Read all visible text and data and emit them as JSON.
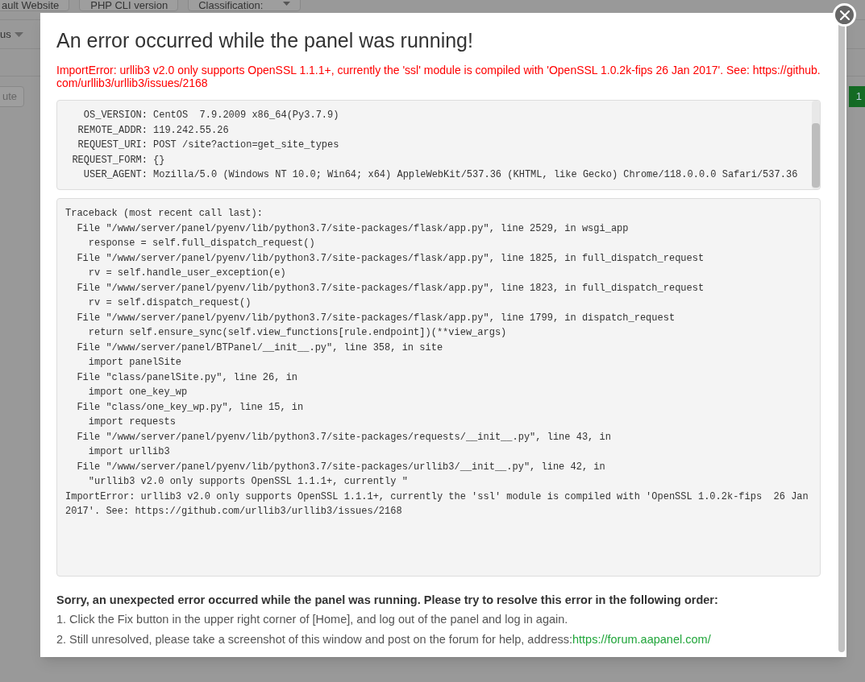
{
  "background": {
    "top_buttons": [
      "ault Website",
      "PHP CLI version"
    ],
    "classification_select": "Classification:",
    "left_menu": "us",
    "left_button": "ute",
    "page_badge": "1"
  },
  "dialog": {
    "title": "An error occurred while the panel was running!",
    "error_message": "ImportError: urllib3 v2.0 only supports OpenSSL 1.1.1+, currently the 'ssl' module is compiled with 'OpenSSL 1.0.2k-fips 26 Jan 2017'. See: https://github.com/urllib3/urllib3/issues/2168",
    "environment": [
      {
        "key": "OS_VERSION:",
        "value": "CentOS  7.9.2009 x86_64(Py3.7.9)"
      },
      {
        "key": "REMOTE_ADDR:",
        "value": "119.242.55.26"
      },
      {
        "key": "REQUEST_URI:",
        "value": "POST /site?action=get_site_types"
      },
      {
        "key": "REQUEST_FORM:",
        "value": "{}"
      },
      {
        "key": "USER_AGENT:",
        "value": "Mozilla/5.0 (Windows NT 10.0; Win64; x64) AppleWebKit/537.36 (KHTML, like Gecko) Chrome/118.0.0.0 Safari/537.36"
      }
    ],
    "traceback": [
      "Traceback (most recent call last):",
      "  File \"/www/server/panel/pyenv/lib/python3.7/site-packages/flask/app.py\", line 2529, in wsgi_app",
      "    response = self.full_dispatch_request()",
      "  File \"/www/server/panel/pyenv/lib/python3.7/site-packages/flask/app.py\", line 1825, in full_dispatch_request",
      "    rv = self.handle_user_exception(e)",
      "  File \"/www/server/panel/pyenv/lib/python3.7/site-packages/flask/app.py\", line 1823, in full_dispatch_request",
      "    rv = self.dispatch_request()",
      "  File \"/www/server/panel/pyenv/lib/python3.7/site-packages/flask/app.py\", line 1799, in dispatch_request",
      "    return self.ensure_sync(self.view_functions[rule.endpoint])(**view_args)",
      "  File \"/www/server/panel/BTPanel/__init__.py\", line 358, in site",
      "    import panelSite",
      "  File \"class/panelSite.py\", line 26, in",
      "    import one_key_wp",
      "  File \"class/one_key_wp.py\", line 15, in",
      "    import requests",
      "  File \"/www/server/panel/pyenv/lib/python3.7/site-packages/requests/__init__.py\", line 43, in",
      "    import urllib3",
      "  File \"/www/server/panel/pyenv/lib/python3.7/site-packages/urllib3/__init__.py\", line 42, in",
      "    \"urllib3 v2.0 only supports OpenSSL 1.1.1+, currently \"",
      "ImportError: urllib3 v2.0 only supports OpenSSL 1.1.1+, currently the 'ssl' module is compiled with 'OpenSSL 1.0.2k-fips  26 Jan 2017'. See: https://github.com/urllib3/urllib3/issues/2168"
    ],
    "help_heading": "Sorry, an unexpected error occurred while the panel was running. Please try to resolve this error in the following order:",
    "help_steps": [
      {
        "text": "1. Click the Fix button in the upper right corner of [Home], and log out of the panel and log in again."
      },
      {
        "text": "2. Still unresolved, please take a screenshot of this window and post on the forum for help, address:",
        "link": "https://forum.aapanel.com/"
      }
    ]
  }
}
